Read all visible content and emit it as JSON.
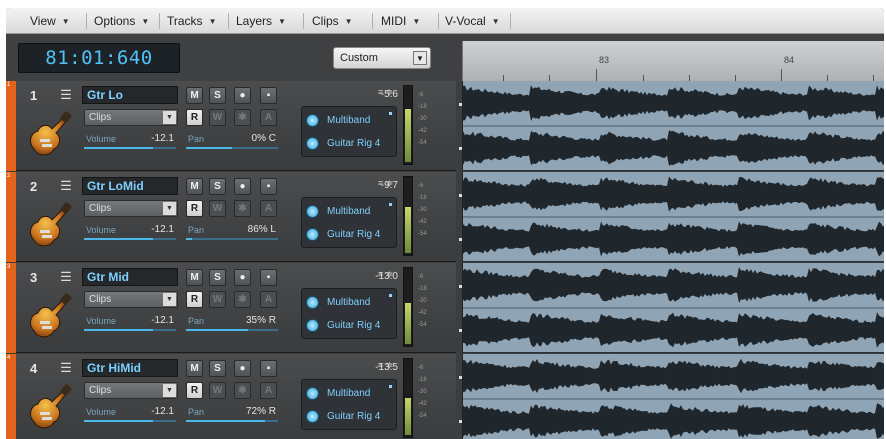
{
  "menu": [
    {
      "label": "View"
    },
    {
      "label": "Options"
    },
    {
      "label": "Tracks"
    },
    {
      "label": "Layers"
    },
    {
      "label": "Clips"
    },
    {
      "label": "MIDI"
    },
    {
      "label": "V-Vocal"
    }
  ],
  "transport": {
    "timecode": "81:01:640"
  },
  "preset": {
    "value": "Custom"
  },
  "ruler": {
    "marks": [
      "83",
      "84"
    ]
  },
  "tracks": [
    {
      "number": "1",
      "name": "Gtr Lo",
      "clips_mode": "Clips",
      "volume_label": "Volume",
      "volume": "-12.1",
      "volume_level": 0.75,
      "pan_label": "Pan",
      "pan": "0% C",
      "pan_level": 0.5,
      "gain": "-5.6",
      "fx": [
        "Multiband",
        "Guitar Rig 4"
      ],
      "meter_level": 0.72,
      "color": "#e2631a"
    },
    {
      "number": "2",
      "name": "Gtr LoMid",
      "clips_mode": "Clips",
      "volume_label": "Volume",
      "volume": "-12.1",
      "volume_level": 0.75,
      "pan_label": "Pan",
      "pan": "86% L",
      "pan_level": 0.07,
      "gain": "-9.7",
      "fx": [
        "Multiband",
        "Guitar Rig 4"
      ],
      "meter_level": 0.62,
      "color": "#e2631a"
    },
    {
      "number": "3",
      "name": "Gtr Mid",
      "clips_mode": "Clips",
      "volume_label": "Volume",
      "volume": "-12.1",
      "volume_level": 0.75,
      "pan_label": "Pan",
      "pan": "35% R",
      "pan_level": 0.67,
      "gain": "-13.0",
      "fx": [
        "Multiband",
        "Guitar Rig 4"
      ],
      "meter_level": 0.55,
      "color": "#e2631a"
    },
    {
      "number": "4",
      "name": "Gtr HiMid",
      "clips_mode": "Clips",
      "volume_label": "Volume",
      "volume": "-12.1",
      "volume_level": 0.75,
      "pan_label": "Pan",
      "pan": "72% R",
      "pan_level": 0.86,
      "gain": "-13.5",
      "fx": [
        "Multiband",
        "Guitar Rig 4"
      ],
      "meter_level": 0.5,
      "color": "#e2631a"
    }
  ],
  "track_buttons": {
    "mute": "M",
    "solo": "S",
    "record": "●",
    "input": "▪",
    "read": "R",
    "write": "W",
    "freeze": "✱",
    "arm": "A"
  },
  "meter_scale": [
    "-6",
    "-18",
    "-30",
    "-42",
    "-54"
  ],
  "colors": {
    "accent": "#4fc3f7",
    "track_color": "#e2631a",
    "lane_bg": "#8fa5b6",
    "waveform": "#1f262c"
  }
}
